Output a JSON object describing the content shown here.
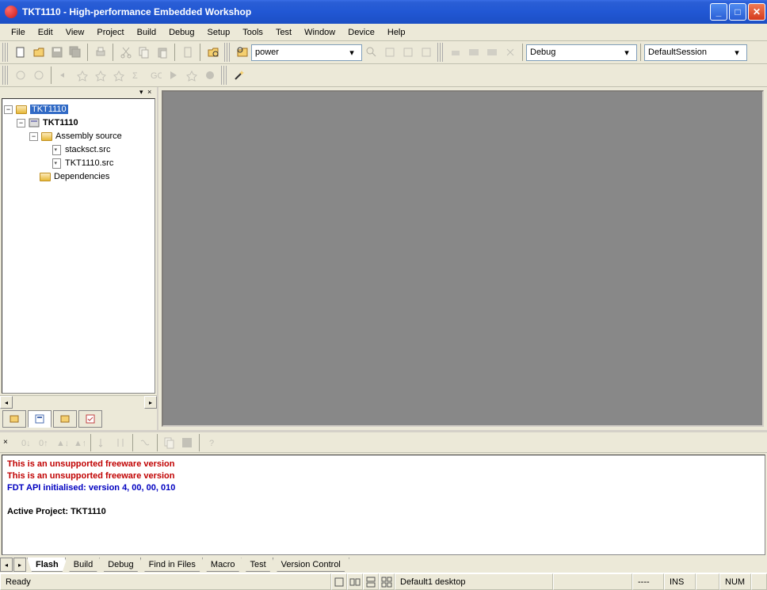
{
  "window": {
    "title": "TKT1110 - High-performance Embedded Workshop"
  },
  "menu": {
    "items": [
      "File",
      "Edit",
      "View",
      "Project",
      "Build",
      "Debug",
      "Setup",
      "Tools",
      "Test",
      "Window",
      "Device",
      "Help"
    ]
  },
  "toolbar": {
    "search_value": "power",
    "config_value": "Debug",
    "session_value": "DefaultSession"
  },
  "tree": {
    "root": "TKT1110",
    "project": "TKT1110",
    "folder1": "Assembly source",
    "file1": "stacksct.src",
    "file2": "TKT1110.src",
    "folder2": "Dependencies"
  },
  "output": {
    "line1": "This is an unsupported freeware version",
    "line2": "This is an unsupported freeware version",
    "line3": "FDT API initialised: version 4, 00, 00, 010",
    "line4": "Active Project: TKT1110",
    "tabs": [
      "Flash",
      "Build",
      "Debug",
      "Find in Files",
      "Macro",
      "Test",
      "Version Control"
    ]
  },
  "status": {
    "ready": "Ready",
    "desktop": "Default1 desktop",
    "dashes": "----",
    "ins": "INS",
    "num": "NUM"
  }
}
